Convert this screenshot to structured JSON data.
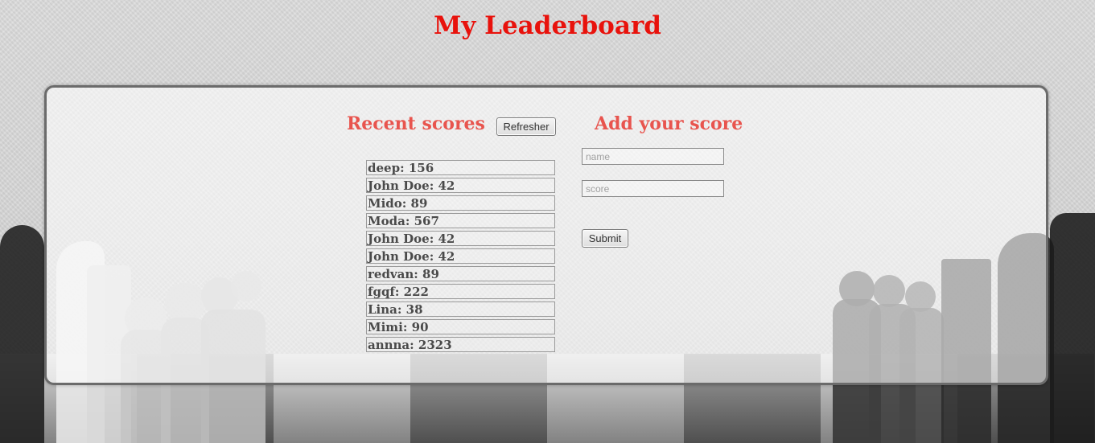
{
  "page": {
    "title": "My Leaderboard"
  },
  "recent": {
    "heading": "Recent scores",
    "refresh_label": "Refresher",
    "scores": [
      "deep: 156",
      "John Doe: 42",
      "Mido: 89",
      "Moda: 567",
      "John Doe: 42",
      "John Doe: 42",
      "redvan: 89",
      "fgqf: 222",
      "Lina: 38",
      "Mimi: 90",
      "annna: 2323"
    ]
  },
  "add": {
    "heading": "Add your score",
    "name_placeholder": "name",
    "score_placeholder": "score",
    "submit_label": "Submit"
  },
  "colors": {
    "title": "#e8120c",
    "section_heading": "#e8544e"
  }
}
